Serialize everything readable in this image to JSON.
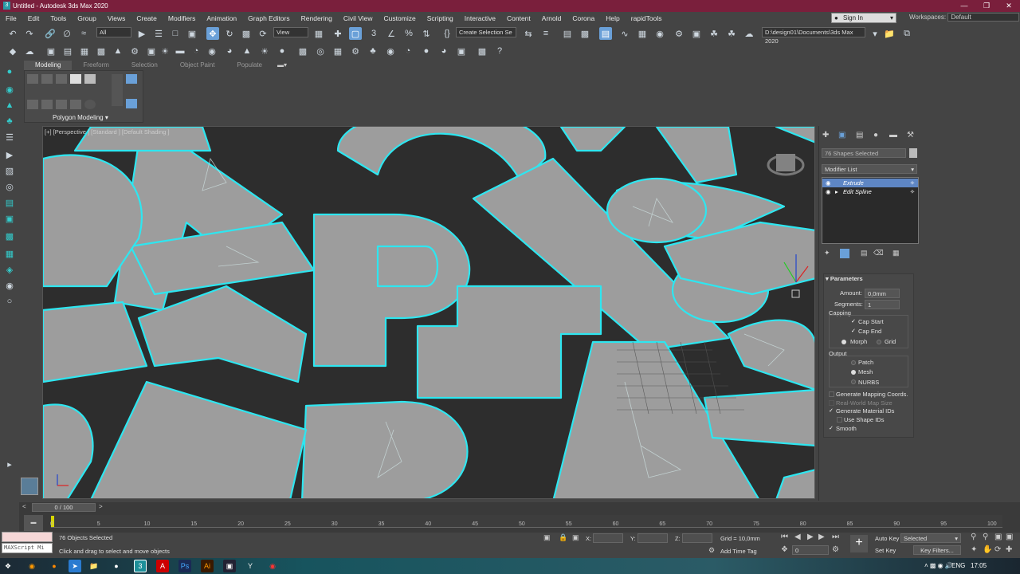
{
  "window": {
    "title": "Untitled - Autodesk 3ds Max 2020"
  },
  "menu": [
    "File",
    "Edit",
    "Tools",
    "Group",
    "Views",
    "Create",
    "Modifiers",
    "Animation",
    "Graph Editors",
    "Rendering",
    "Civil View",
    "Customize",
    "Scripting",
    "Interactive",
    "Content",
    "Arnold",
    "Corona",
    "Help",
    "rapidTools"
  ],
  "account": {
    "sign_in": "Sign In",
    "workspaces_label": "Workspaces:",
    "workspace": "Default"
  },
  "toolbar": {
    "selection_filter": "All",
    "ref_coord": "View",
    "selection_set": "Create Selection Se",
    "project_path": "D:\\design01\\Documents\\3ds Max 2020"
  },
  "ribbon": {
    "tabs": [
      "Modeling",
      "Freeform",
      "Selection",
      "Object Paint",
      "Populate"
    ],
    "active_tab": "Modeling",
    "panel_label": "Polygon Modeling"
  },
  "viewport": {
    "label": "[+] [Perspective ] [Standard ] [Default Shading ]"
  },
  "command_panel": {
    "selection_name": "76 Shapes Selected",
    "modifier_list": "Modifier List",
    "stack": [
      {
        "name": "Extrude",
        "selected": true
      },
      {
        "name": "Edit Spline",
        "selected": false
      }
    ],
    "params": {
      "title": "Parameters",
      "amount_label": "Amount:",
      "amount": "0,0mm",
      "segments_label": "Segments:",
      "segments": "1",
      "capping_label": "Capping",
      "cap_start": "Cap Start",
      "cap_end": "Cap End",
      "morph": "Morph",
      "grid": "Grid",
      "output_label": "Output",
      "patch": "Patch",
      "mesh": "Mesh",
      "nurbs": "NURBS",
      "gen_mapping": "Generate Mapping Coords.",
      "real_world": "Real-World Map Size",
      "gen_material": "Generate Material IDs",
      "use_shape_ids": "Use Shape IDs",
      "smooth": "Smooth"
    }
  },
  "timeline": {
    "frame": "0 / 100",
    "ticks": [
      "0",
      "5",
      "10",
      "15",
      "20",
      "25",
      "30",
      "35",
      "40",
      "45",
      "50",
      "55",
      "60",
      "65",
      "70",
      "75",
      "80",
      "85",
      "90",
      "95",
      "100"
    ]
  },
  "status": {
    "maxscript": "MAXScript Mi",
    "objects_selected": "76 Objects Selected",
    "prompt": "Click and drag to select and move objects",
    "x_label": "X:",
    "y_label": "Y:",
    "z_label": "Z:",
    "grid": "Grid = 10,0mm",
    "add_time_tag": "Add Time Tag",
    "auto_key": "Auto Key",
    "set_key": "Set Key",
    "selected": "Selected",
    "key_filters": "Key Filters...",
    "frame_field": "0"
  },
  "taskbar": {
    "lang": "ENG",
    "time": "17:05"
  }
}
